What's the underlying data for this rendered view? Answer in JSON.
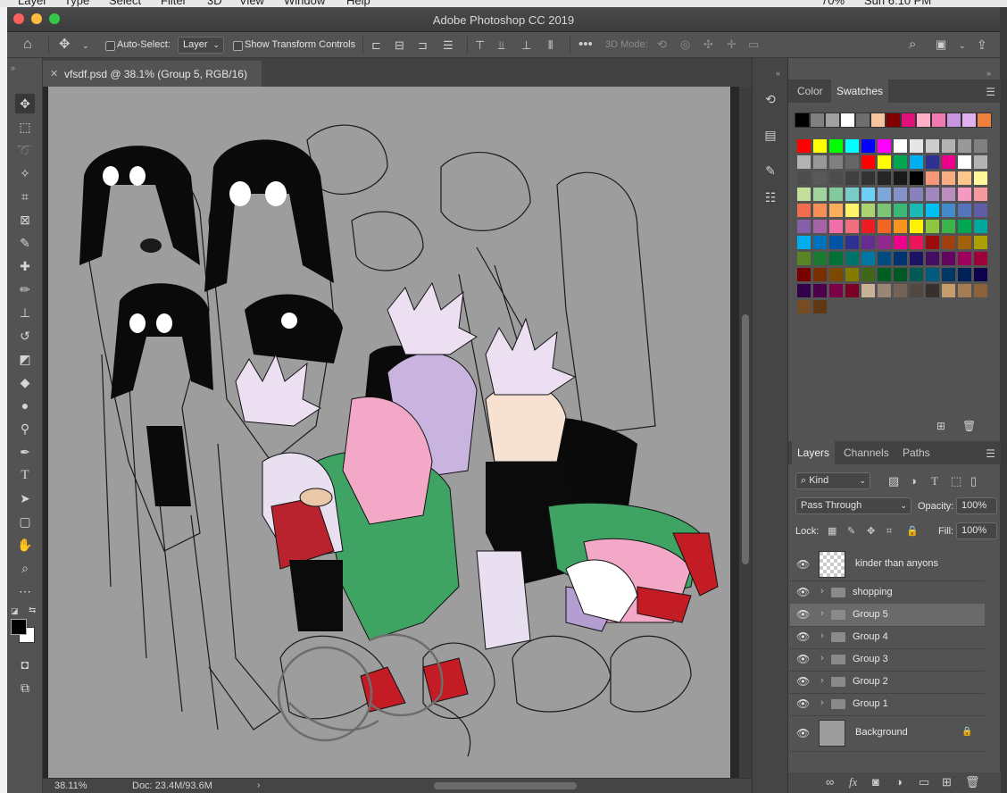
{
  "menubar": {
    "items": [
      "Layer",
      "Type",
      "Select",
      "Filter",
      "3D",
      "View",
      "Window",
      "Help"
    ],
    "battery": "70%",
    "clock": "Sun 6:10 PM"
  },
  "window": {
    "title": "Adobe Photoshop CC 2019"
  },
  "options": {
    "auto_select_label": "Auto-Select:",
    "auto_select_value": "Layer",
    "show_transform_label": "Show Transform Controls",
    "mode_3d_label": "3D Mode:"
  },
  "document": {
    "tab_title": "vfsdf.psd @ 38.1% (Group 5, RGB/16)"
  },
  "status": {
    "zoom": "38.11%",
    "doc_size": "Doc: 23.4M/93.6M"
  },
  "swatches_panel": {
    "tabs": [
      "Color",
      "Swatches"
    ],
    "active_tab": "Swatches",
    "recent": [
      "#000000",
      "#808080",
      "#a0a0a0",
      "#ffffff",
      "#6e6e6e",
      "#f5c5a0",
      "#800000",
      "#e0107a",
      "#ffb0c8",
      "#f07ab0",
      "#c896e0",
      "#e0b0f0",
      "#f08040"
    ],
    "grid": [
      [
        "#ff0000",
        "#ffff00",
        "#00ff00",
        "#00ffff",
        "#0000ff",
        "#ff00ff",
        "#ffffff",
        "#e6e6e6",
        "#cccccc",
        "#b3b3b3",
        "#999999",
        "#808080"
      ],
      [
        "#b3b3b3",
        "#999999",
        "#808080",
        "#666666",
        "#ff0000",
        "#ffff00",
        "#00a651",
        "#00aeef",
        "#2e3192",
        "#ec008c",
        "#ffffff",
        "#b3b3b3"
      ],
      [
        "#4d4d4d",
        "#595959",
        "#4d4d4d",
        "#404040",
        "#333333",
        "#262626",
        "#1a1a1a",
        "#000000",
        "#f7977a",
        "#f9ad81",
        "#fdc68a",
        "#fff79a"
      ],
      [
        "#c4df9b",
        "#a3d39c",
        "#82ca9d",
        "#7accc8",
        "#6dcff6",
        "#7da7d9",
        "#8393ca",
        "#8781bd",
        "#a187be",
        "#bc8dbf",
        "#f49ac2",
        "#f6989d"
      ],
      [
        "#f26c4f",
        "#f68e55",
        "#fbaf5d",
        "#fff467",
        "#acd372",
        "#7cc576",
        "#3bb878",
        "#1abbb4",
        "#00bff3",
        "#438ccb",
        "#5574b9",
        "#605ca8"
      ],
      [
        "#855fa8",
        "#a763a8",
        "#f06eaa",
        "#f26d7d",
        "#ed1c24",
        "#f26522",
        "#f7941d",
        "#fff200",
        "#8dc63f",
        "#39b54a",
        "#00a651",
        "#00a99d"
      ],
      [
        "#00aeef",
        "#0072bc",
        "#0054a6",
        "#2e3192",
        "#662d91",
        "#92278f",
        "#ec008c",
        "#ed145b",
        "#9e0b0f",
        "#a0410d",
        "#a3620a",
        "#aba000"
      ],
      [
        "#598527",
        "#1a7b30",
        "#007236",
        "#00746b",
        "#0076a3",
        "#004b80",
        "#003471",
        "#1b1464",
        "#440e62",
        "#630460",
        "#9e005d",
        "#9e0039"
      ],
      [
        "#790000",
        "#7b2e00",
        "#7d4900",
        "#827b00",
        "#406618",
        "#005e20",
        "#005826",
        "#005952",
        "#005b7f",
        "#003663",
        "#002157",
        "#0d004c"
      ],
      [
        "#32004b",
        "#4b0049",
        "#7b0046",
        "#7a0026",
        "#c7b299",
        "#998675",
        "#736357",
        "#534741",
        "#37302d",
        "#c69c6d",
        "#a67c52",
        "#8c6239"
      ],
      [
        "#754c24",
        "#603913"
      ]
    ]
  },
  "layers_panel": {
    "tabs": [
      "Layers",
      "Channels",
      "Paths"
    ],
    "active_tab": "Layers",
    "kind_label": "Kind",
    "blend_mode": "Pass Through",
    "opacity_label": "Opacity:",
    "opacity_value": "100%",
    "lock_label": "Lock:",
    "fill_label": "Fill:",
    "fill_value": "100%",
    "layers": [
      {
        "name": "kinder than anyons",
        "type": "layer"
      },
      {
        "name": "shopping",
        "type": "group"
      },
      {
        "name": "Group 5",
        "type": "group",
        "selected": true
      },
      {
        "name": "Group 4",
        "type": "group"
      },
      {
        "name": "Group 3",
        "type": "group"
      },
      {
        "name": "Group 2",
        "type": "group"
      },
      {
        "name": "Group 1",
        "type": "group"
      },
      {
        "name": "Background",
        "type": "background",
        "locked": true
      }
    ]
  },
  "colors": {
    "canvas_bg": "#9d9d9d",
    "panel_bg": "#535353",
    "selected_row": "#6a6a6a"
  }
}
